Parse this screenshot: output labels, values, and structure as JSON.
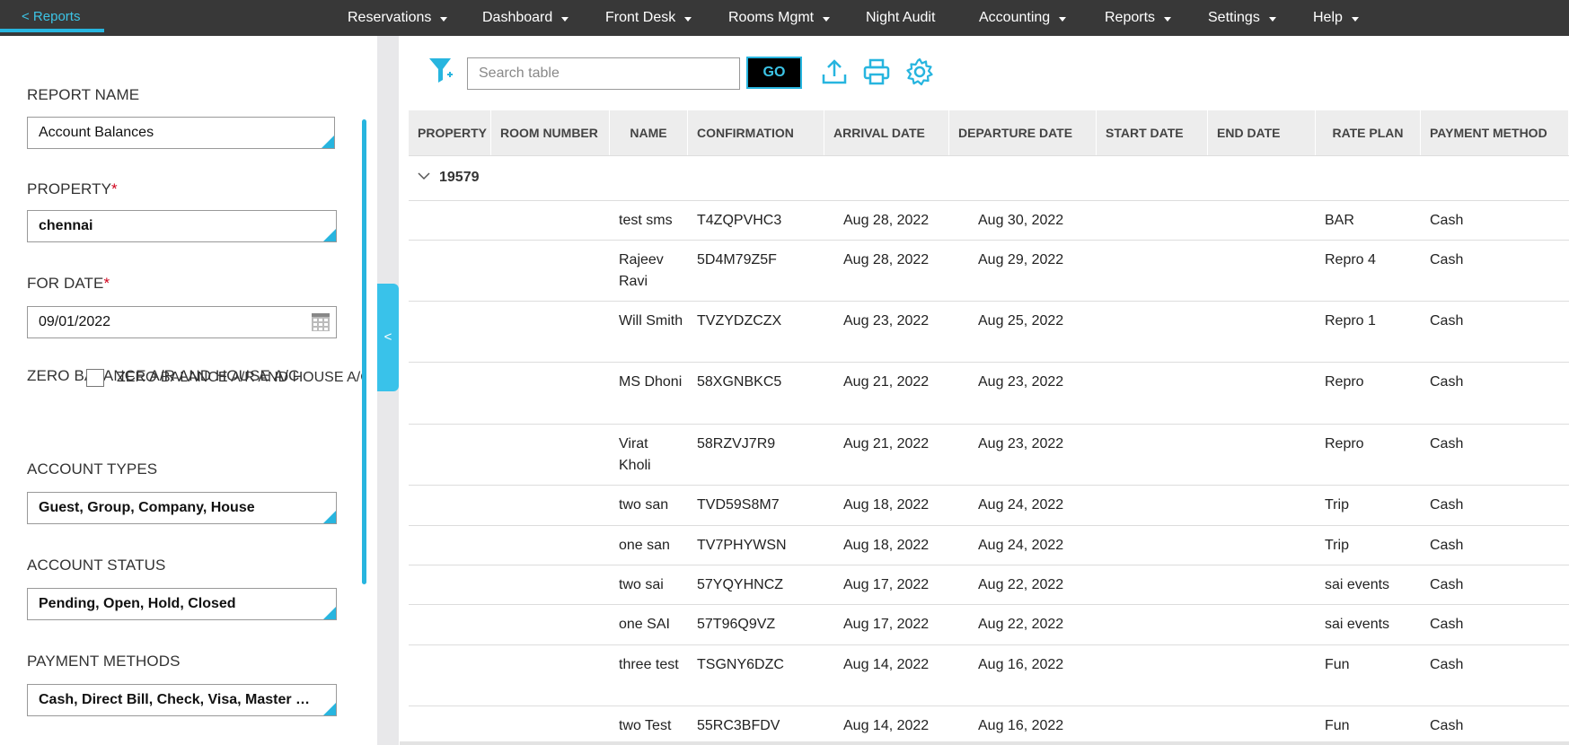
{
  "nav": {
    "back_label": "< Reports",
    "items": [
      {
        "label": "Reservations",
        "caret": true
      },
      {
        "label": "Dashboard",
        "caret": true
      },
      {
        "label": "Front Desk",
        "caret": true
      },
      {
        "label": "Rooms Mgmt",
        "caret": true
      },
      {
        "label": "Night Audit",
        "caret": false
      },
      {
        "label": "Accounting",
        "caret": true
      },
      {
        "label": "Reports",
        "caret": true
      },
      {
        "label": "Settings",
        "caret": true
      },
      {
        "label": "Help",
        "caret": true
      }
    ]
  },
  "filters": {
    "report_name": {
      "label": "REPORT NAME",
      "value": "Account Balances"
    },
    "property": {
      "label": "PROPERTY",
      "required": "*",
      "value": "chennai"
    },
    "for_date": {
      "label": "FOR DATE",
      "required": "*",
      "value": "09/01/2022"
    },
    "zero_balance": {
      "label": "ZERO BALANCE A/R AND HOUSE A/C",
      "checkbox_label": "ZERO BALANCE A/R AND HOUSE A/C",
      "checked": false
    },
    "account_types": {
      "label": "ACCOUNT TYPES",
      "value": "Guest, Group, Company, House"
    },
    "account_status": {
      "label": "ACCOUNT STATUS",
      "value": "Pending, Open, Hold, Closed"
    },
    "payment_methods": {
      "label": "PAYMENT METHODS",
      "value": "Cash, Direct Bill, Check, Visa, Master Car..."
    }
  },
  "toolbar": {
    "search_placeholder": "Search table",
    "go_label": "GO",
    "icons": [
      "filter-icon",
      "upload-icon",
      "print-icon",
      "settings-gear-icon"
    ]
  },
  "table": {
    "columns": [
      "PROPERTY",
      "ROOM NUMBER",
      "NAME",
      "CONFIRMATION",
      "ARRIVAL DATE",
      "DEPARTURE DATE",
      "START DATE",
      "END DATE",
      "RATE PLAN",
      "PAYMENT METHOD"
    ],
    "group": "19579",
    "rows": [
      {
        "name": "test sms",
        "confirmation": "T4ZQPVHC3",
        "arrival": "Aug 28, 2022",
        "departure": "Aug 30, 2022",
        "rate_plan": "BAR",
        "payment": "Cash"
      },
      {
        "name": "Rajeev Ravi",
        "confirmation": "5D4M79Z5F",
        "arrival": "Aug 28, 2022",
        "departure": "Aug 29, 2022",
        "rate_plan": "Repro 4",
        "payment": "Cash"
      },
      {
        "name": "Will Smith",
        "confirmation": "TVZYDZCZX",
        "arrival": "Aug 23, 2022",
        "departure": "Aug 25, 2022",
        "rate_plan": "Repro 1",
        "payment": "Cash"
      },
      {
        "name": "MS Dhoni",
        "confirmation": "58XGNBKC5",
        "arrival": "Aug 21, 2022",
        "departure": "Aug 23, 2022",
        "rate_plan": "Repro",
        "payment": "Cash"
      },
      {
        "name": "Virat Kholi",
        "confirmation": "58RZVJ7R9",
        "arrival": "Aug 21, 2022",
        "departure": "Aug 23, 2022",
        "rate_plan": "Repro",
        "payment": "Cash"
      },
      {
        "name": "two san",
        "confirmation": "TVD59S8M7",
        "arrival": "Aug 18, 2022",
        "departure": "Aug 24, 2022",
        "rate_plan": "Trip",
        "payment": "Cash"
      },
      {
        "name": "one san",
        "confirmation": "TV7PHYWSN",
        "arrival": "Aug 18, 2022",
        "departure": "Aug 24, 2022",
        "rate_plan": "Trip",
        "payment": "Cash"
      },
      {
        "name": "two sai",
        "confirmation": "57YQYHNCZ",
        "arrival": "Aug 17, 2022",
        "departure": "Aug 22, 2022",
        "rate_plan": "sai events",
        "payment": "Cash"
      },
      {
        "name": "one SAI",
        "confirmation": "57T96Q9VZ",
        "arrival": "Aug 17, 2022",
        "departure": "Aug 22, 2022",
        "rate_plan": "sai events",
        "payment": "Cash"
      },
      {
        "name": "three test",
        "confirmation": "TSGNY6DZC",
        "arrival": "Aug 14, 2022",
        "departure": "Aug 16, 2022",
        "rate_plan": "Fun",
        "payment": "Cash"
      },
      {
        "name": "two Test",
        "confirmation": "55RC3BFDV",
        "arrival": "Aug 14, 2022",
        "departure": "Aug 16, 2022",
        "rate_plan": "Fun",
        "payment": "Cash"
      }
    ]
  },
  "colors": {
    "accent": "#27b5df",
    "nav_bg": "#383838",
    "header_bg": "#ededed"
  }
}
